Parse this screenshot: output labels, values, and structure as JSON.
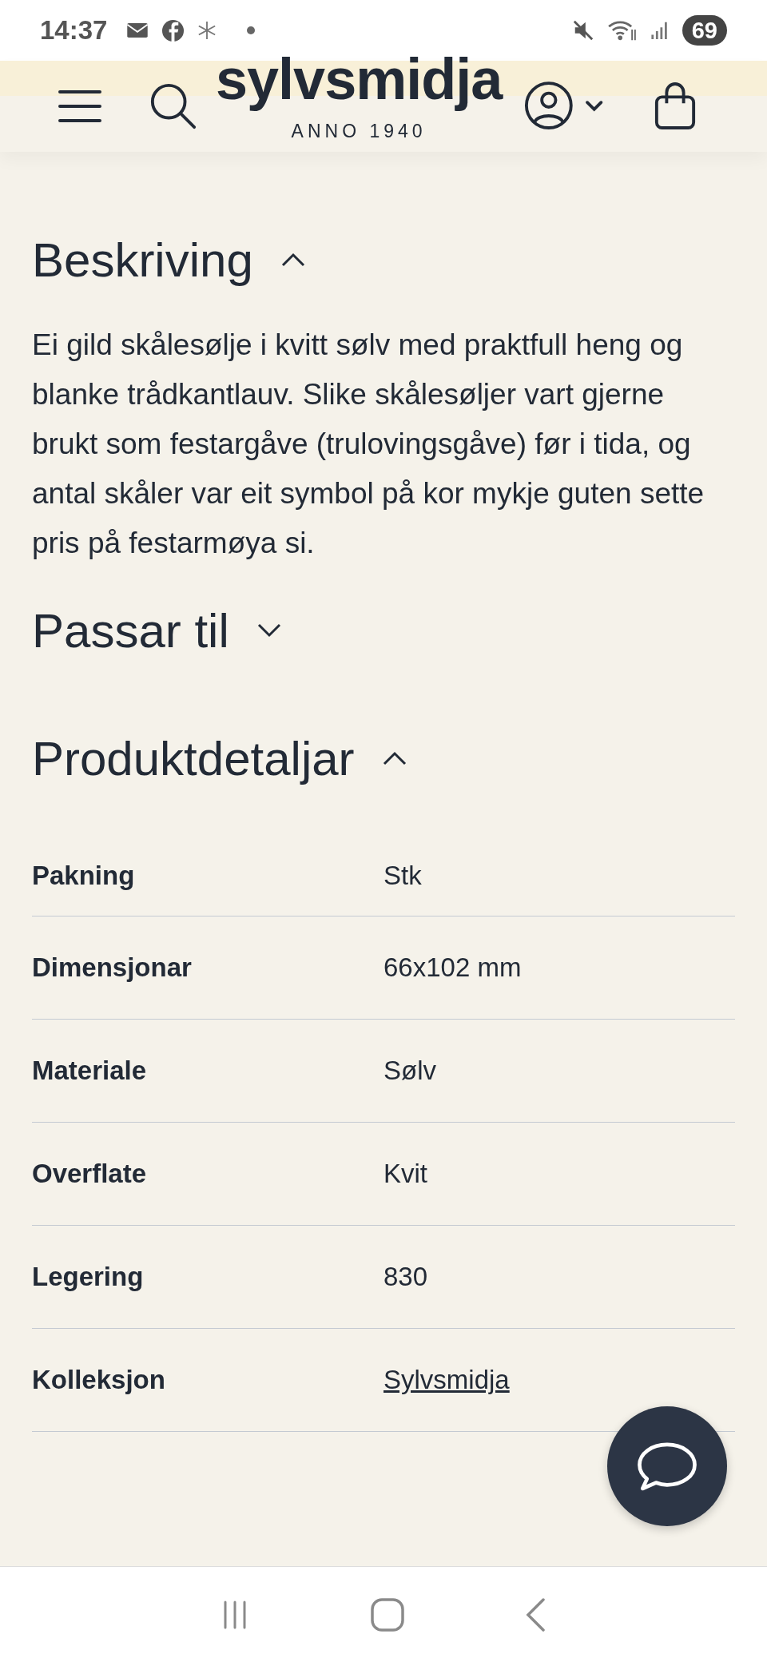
{
  "status_bar": {
    "time": "14:37",
    "battery": "69"
  },
  "header": {
    "logo": "sylvsmidja",
    "tagline": "ANNO 1940"
  },
  "sections": [
    {
      "kind": "text",
      "title": "Beskriving",
      "expanded": true,
      "body": "Ei gild skålesølje i kvitt sølv med praktfull heng og blanke trådkantlauv. Slike skålesøljer vart gjerne brukt som festargåve (trulovingsgåve) før i tida, og antal skåler var eit symbol på kor mykje guten sette pris på festarmøya si."
    },
    {
      "title": "Passar til",
      "expanded": false
    },
    {
      "kind": "table",
      "title": "Produktdetaljar",
      "expanded": true,
      "rows": [
        {
          "label": "Pakning",
          "value": "Stk",
          "link": false
        },
        {
          "label": "Dimensjonar",
          "value": "66x102 mm",
          "link": false
        },
        {
          "label": "Materiale",
          "value": "Sølv",
          "link": false
        },
        {
          "label": "Overflate",
          "value": "Kvit",
          "link": false
        },
        {
          "label": "Legering",
          "value": "830",
          "link": false
        },
        {
          "label": "Kolleksjon",
          "value": "Sylvsmidja",
          "link": true
        }
      ]
    }
  ]
}
